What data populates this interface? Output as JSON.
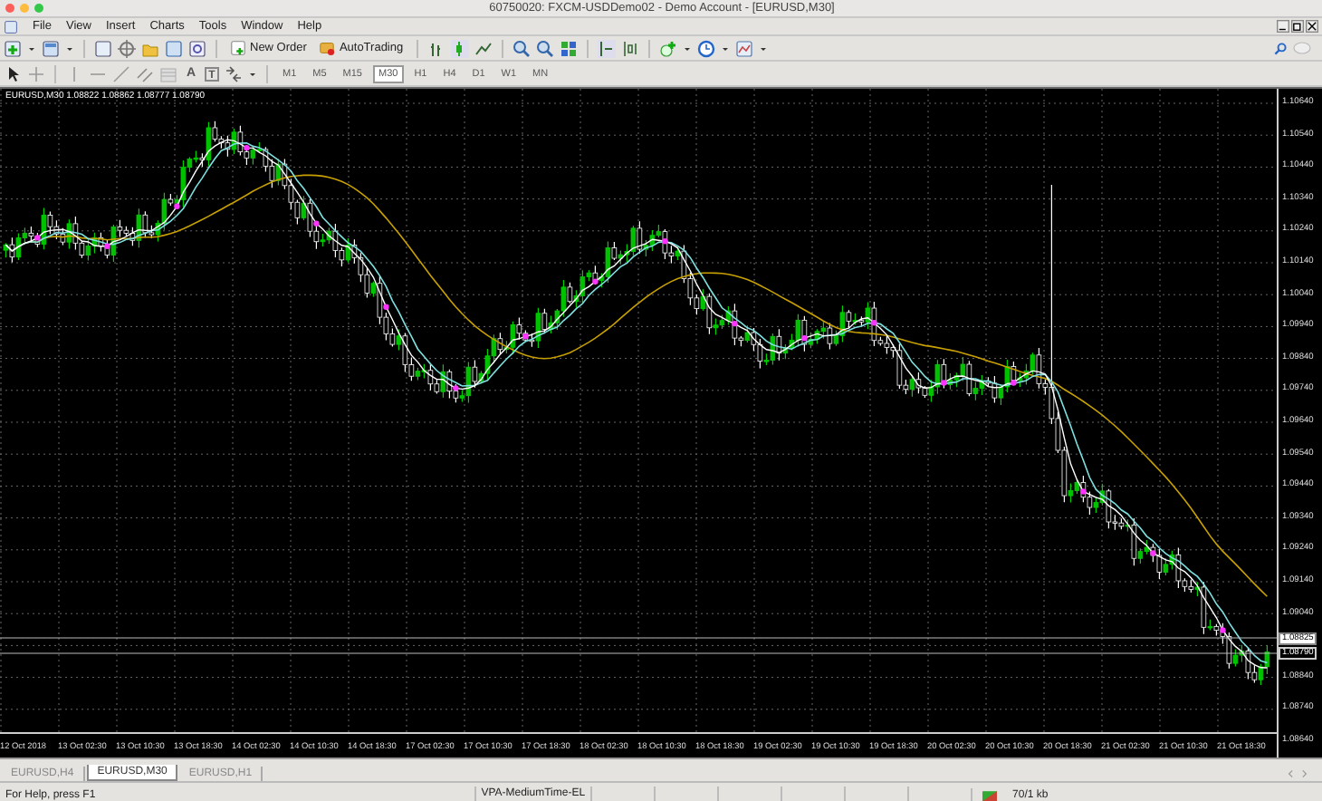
{
  "window": {
    "title": "60750020: FXCM-USDDemo02 - Demo Account - [EURUSD,M30]"
  },
  "menu": [
    "File",
    "View",
    "Insert",
    "Charts",
    "Tools",
    "Window",
    "Help"
  ],
  "toolbar": {
    "new_order": "New Order",
    "autotrading": "AutoTrading"
  },
  "drawing_tools": {
    "text_tool": "A",
    "label_tool": "T"
  },
  "timeframes": [
    {
      "label": "M1",
      "selected": false
    },
    {
      "label": "M5",
      "selected": false
    },
    {
      "label": "M15",
      "selected": false
    },
    {
      "label": "M30",
      "selected": true
    },
    {
      "label": "H1",
      "selected": false
    },
    {
      "label": "H4",
      "selected": false
    },
    {
      "label": "D1",
      "selected": false
    },
    {
      "label": "W1",
      "selected": false
    },
    {
      "label": "MN",
      "selected": false
    }
  ],
  "chart": {
    "header": "EURUSD,M30 1.08822 1.08862 1.08777 1.08790",
    "price_labels": [
      "1.10640",
      "1.10540",
      "1.10440",
      "1.10340",
      "1.10240",
      "1.10140",
      "1.10040",
      "1.09940",
      "1.09840",
      "1.09740",
      "1.09640",
      "1.09540",
      "1.09440",
      "1.09340",
      "1.09240",
      "1.09140",
      "1.09040",
      "1.08840",
      "1.08740",
      "1.08640"
    ],
    "bid_label": "1.08825",
    "close_label": "1.08790",
    "time_labels": [
      "12 Oct 2018",
      "13 Oct 02:30",
      "13 Oct 10:30",
      "13 Oct 18:30",
      "14 Oct 02:30",
      "14 Oct 10:30",
      "14 Oct 18:30",
      "17 Oct 02:30",
      "17 Oct 10:30",
      "17 Oct 18:30",
      "18 Oct 02:30",
      "18 Oct 10:30",
      "18 Oct 18:30",
      "19 Oct 02:30",
      "19 Oct 10:30",
      "19 Oct 18:30",
      "20 Oct 02:30",
      "20 Oct 10:30",
      "20 Oct 18:30",
      "21 Oct 02:30",
      "21 Oct 10:30",
      "21 Oct 18:30"
    ]
  },
  "chart_tabs": [
    {
      "label": "EURUSD,H4",
      "selected": false
    },
    {
      "label": "EURUSD,M30",
      "selected": true
    },
    {
      "label": "EURUSD,H1",
      "selected": false
    }
  ],
  "status_bar": {
    "help": "For Help, press F1",
    "template": "VPA-MediumTime-EL",
    "traffic": "70/1 kb"
  }
}
